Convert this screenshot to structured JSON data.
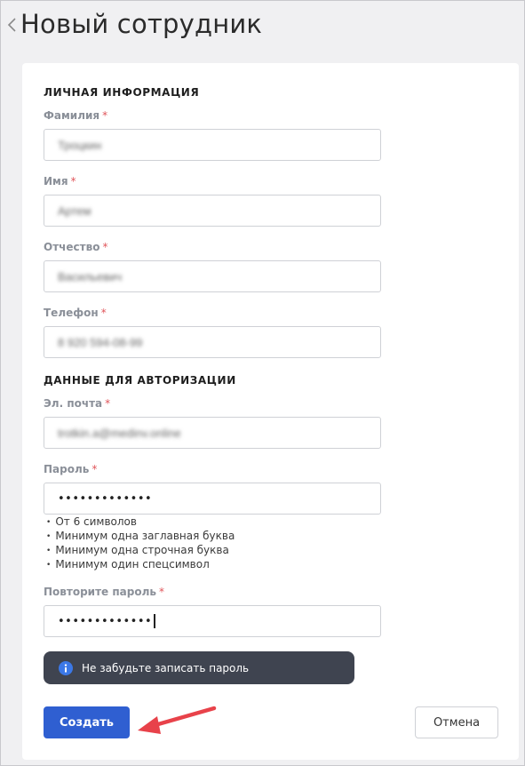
{
  "header": {
    "title": "Новый сотрудник",
    "back_icon": "chevron-left-icon"
  },
  "personal": {
    "section_title": "ЛИЧНАЯ ИНФОРМАЦИЯ",
    "last_name": {
      "label": "Фамилия",
      "required_mark": "*",
      "value": "Троцкин"
    },
    "first_name": {
      "label": "Имя",
      "required_mark": "*",
      "value": "Артем"
    },
    "patronymic": {
      "label": "Отчество",
      "required_mark": "*",
      "value": "Васильевич"
    },
    "phone": {
      "label": "Телефон",
      "required_mark": "*",
      "value": "8 920 594-08-99"
    }
  },
  "auth": {
    "section_title": "ДАННЫЕ ДЛЯ АВТОРИЗАЦИИ",
    "email": {
      "label": "Эл. почта",
      "required_mark": "*",
      "value": "trotkin.a@medinv.online"
    },
    "password": {
      "label": "Пароль",
      "required_mark": "*",
      "masked_value": "•••••••••••••"
    },
    "password_hints": [
      "От 6 символов",
      "Минимум одна заглавная буква",
      "Минимум одна строчная буква",
      "Минимум один спецсимвол"
    ],
    "repeat_password": {
      "label": "Повторите пароль",
      "required_mark": "*",
      "masked_value": "•••••••••••••"
    }
  },
  "notice": {
    "icon": "info-icon",
    "text": "Не забудьте записать пароль"
  },
  "actions": {
    "create_label": "Создать",
    "cancel_label": "Отмена"
  },
  "colors": {
    "primary": "#2f5fd1",
    "notice_bg": "#3f4450",
    "required": "#e0555a",
    "arrow": "#e8424a",
    "page_bg": "#f0f0f2"
  }
}
